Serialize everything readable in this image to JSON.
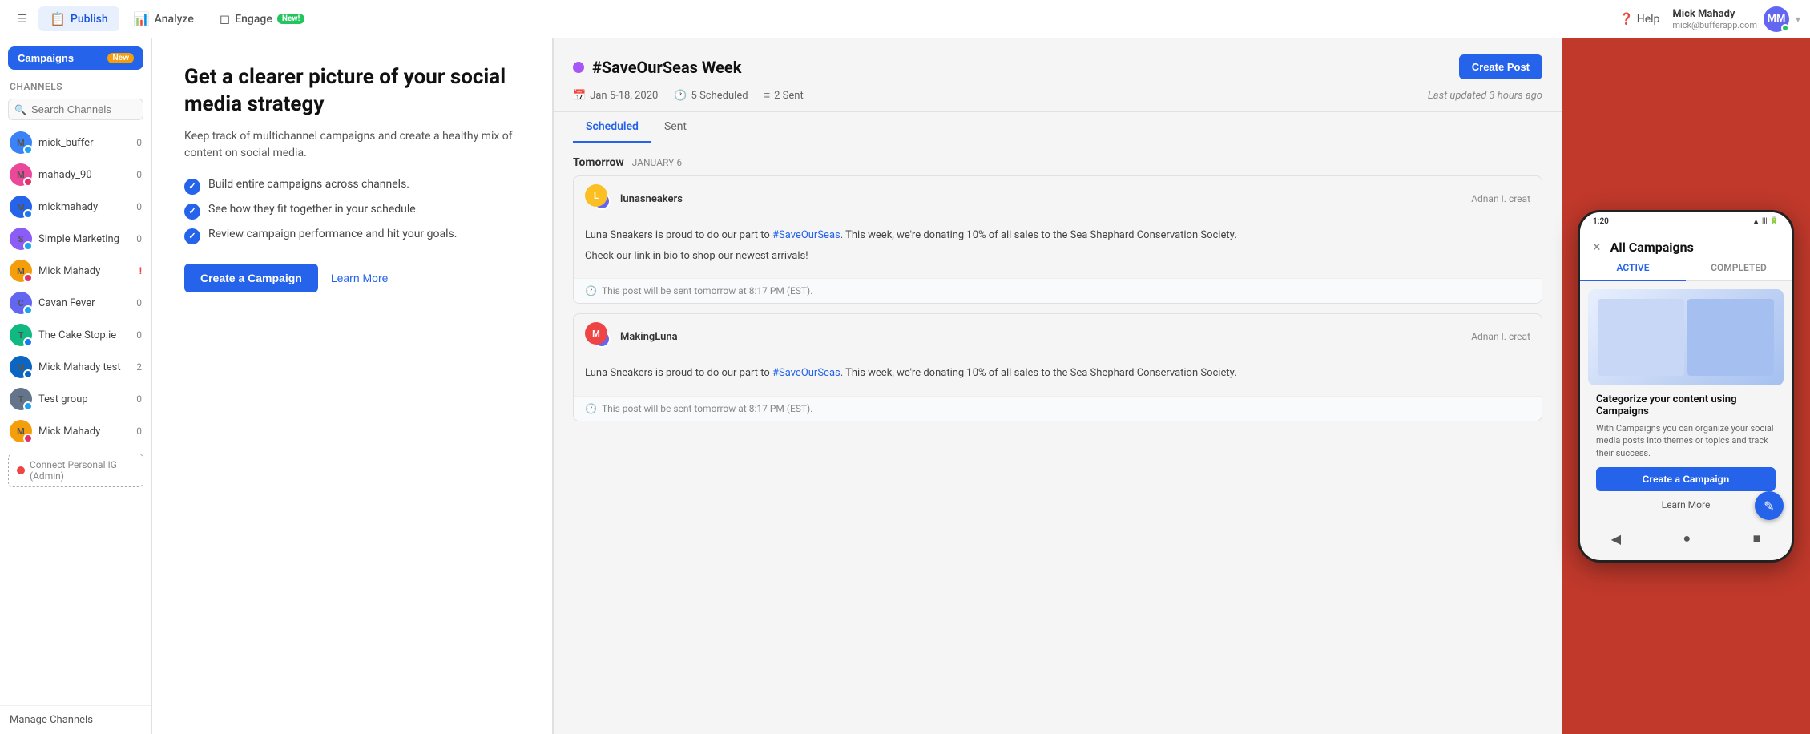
{
  "nav": {
    "hamburger_icon": "☰",
    "tabs": [
      {
        "id": "publish",
        "label": "Publish",
        "icon": "📋",
        "active": true
      },
      {
        "id": "analyze",
        "label": "Analyze",
        "icon": "📊",
        "active": false
      },
      {
        "id": "engage",
        "label": "Engage",
        "icon": "◻",
        "active": false,
        "badge": "New!"
      }
    ],
    "help_label": "Help",
    "help_icon": "?",
    "user": {
      "name": "Mick Mahady",
      "email": "mick@bufferapp.com",
      "initials": "MM"
    }
  },
  "sidebar": {
    "campaigns_button": "Campaigns",
    "campaigns_badge": "New",
    "channels_label": "Channels",
    "search_placeholder": "Search Channels",
    "channels": [
      {
        "name": "mick_buffer",
        "count": "0",
        "platform": "twitter",
        "color": "#3b82f6"
      },
      {
        "name": "mahady_90",
        "count": "0",
        "platform": "instagram",
        "color": "#ec4899"
      },
      {
        "name": "mickmahady",
        "count": "0",
        "platform": "facebook",
        "color": "#2563eb"
      },
      {
        "name": "Simple Marketing",
        "count": "0",
        "platform": "twitter",
        "color": "#8b5cf6"
      },
      {
        "name": "Mick Mahady",
        "count": "!",
        "platform": "instagram",
        "alert": true,
        "color": "#f59e0b"
      },
      {
        "name": "Cavan Fever",
        "count": "0",
        "platform": "twitter",
        "color": "#6366f1"
      },
      {
        "name": "The Cake Stop.ie",
        "count": "0",
        "platform": "facebook",
        "color": "#10b981"
      },
      {
        "name": "Mick Mahady test",
        "count": "2",
        "platform": "linkedin",
        "color": "#0a66c2"
      },
      {
        "name": "Test group",
        "count": "0",
        "platform": "twitter",
        "color": "#64748b"
      },
      {
        "name": "Mick Mahady",
        "count": "0",
        "platform": "instagram",
        "color": "#f59e0b"
      }
    ],
    "connect_label": "Connect Personal IG (Admin)",
    "manage_label": "Manage Channels"
  },
  "campaigns": {
    "title": "Get a clearer picture of your social media strategy",
    "description": "Keep track of multichannel campaigns and create a healthy mix of content on social media.",
    "features": [
      "Build entire campaigns across channels.",
      "See how they fit together in your schedule.",
      "Review campaign performance and hit your goals."
    ],
    "create_btn": "Create a Campaign",
    "learn_more_btn": "Learn More"
  },
  "campaign_detail": {
    "title": "#SaveOurSeas Week",
    "dot_color": "#a855f7",
    "date_range": "Jan 5-18, 2020",
    "scheduled_count": "5 Scheduled",
    "sent_count": "2 Sent",
    "last_updated": "Last updated 3 hours ago",
    "create_post_btn": "Create Post",
    "tabs": [
      {
        "label": "Scheduled",
        "active": true
      },
      {
        "label": "Sent",
        "active": false
      }
    ],
    "sections": [
      {
        "day": "Tomorrow",
        "date": "JANUARY 6",
        "posts": [
          {
            "author": "lunasneakers",
            "creator": "Adnan I. creat",
            "body_lines": [
              "Luna Sneakers is proud to do our part to #SaveOurSeas. This week, we're donating 10% of all sales to the Sea Shephard Conservation Society.",
              "",
              "Check our link in bio to shop our newest arrivals!"
            ],
            "hashtag": "#SaveOurSeas",
            "footer": "This post will be sent tomorrow at 8:17 PM (EST).",
            "avatar_color": "#fbbf24",
            "avatar2_color": "#6366f1"
          },
          {
            "author": "MakingLuna",
            "creator": "Adnan I. creat",
            "body_lines": [
              "Luna Sneakers is proud to do our part to #SaveOurSeas. This week, we're donating 10% of all sales to the Sea Shephard Conservation Society."
            ],
            "hashtag": "#SaveOurSeas",
            "footer": "This post will be sent tomorrow at 8:17 PM (EST).",
            "avatar_color": "#ef4444",
            "avatar2_color": "#6366f1"
          }
        ]
      }
    ]
  },
  "phone": {
    "status_time": "1:20",
    "header_title": "All Campaigns",
    "close_icon": "×",
    "tabs": [
      {
        "label": "ACTIVE",
        "active": true
      },
      {
        "label": "COMPLETED",
        "active": false
      }
    ],
    "categorize_title": "Categorize your content using Campaigns",
    "categorize_desc": "With Campaigns you can organize your social media posts into themes or topics and track their success.",
    "create_btn": "Create a Campaign",
    "learn_more": "Learn More",
    "nav_back": "◀",
    "nav_home": "●",
    "nav_square": "■",
    "fab_icon": "✎"
  }
}
